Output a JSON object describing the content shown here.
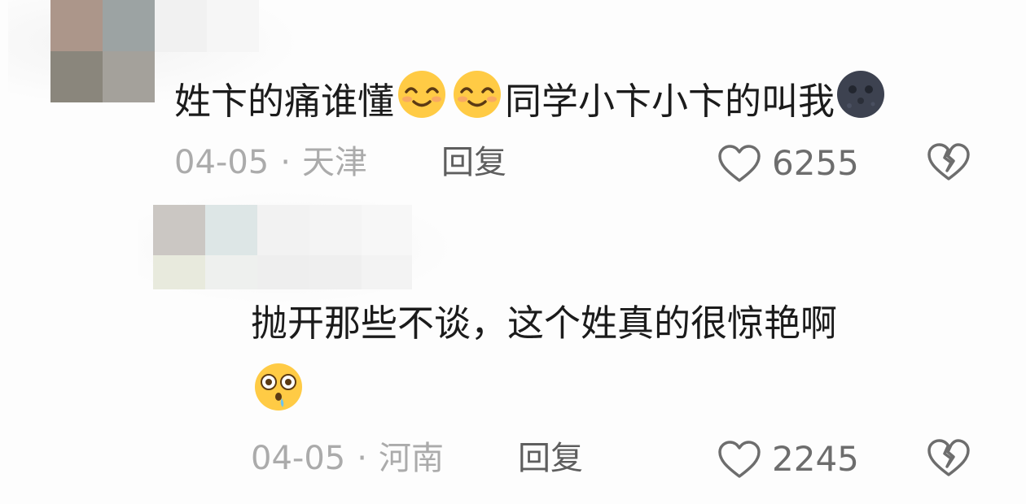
{
  "comments": [
    {
      "text_before": "姓卞的痛谁懂",
      "emoji_1": "smiling-face-icon",
      "emoji_2": "smiling-face-icon",
      "text_after": "同学小卞小卞的叫我",
      "emoji_3": "new-moon-face-icon",
      "date": "04-05",
      "separator": "·",
      "location": "天津",
      "reply_label": "回复",
      "like_count": "6255"
    },
    {
      "text": "抛开那些不谈，这个姓真的很惊艳啊",
      "emoji": "astonished-drooling-face-icon",
      "date": "04-05",
      "separator": "·",
      "location": "河南",
      "reply_label": "回复",
      "like_count": "2245"
    }
  ],
  "colors": {
    "text": "#1b1b1b",
    "meta": "#ababab",
    "action": "#5e5e5e",
    "emoji_yellow": "#ffcb45",
    "emoji_dark": "#3d4250"
  }
}
